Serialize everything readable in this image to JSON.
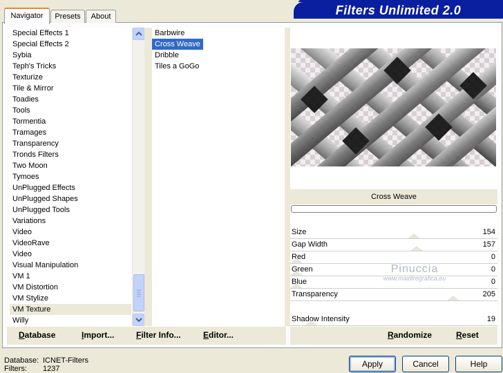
{
  "banner": {
    "title": "Filters Unlimited 2.0"
  },
  "tabs": [
    {
      "label": "Navigator"
    },
    {
      "label": "Presets"
    },
    {
      "label": "About"
    }
  ],
  "categories": {
    "items": [
      "Special Effects 1",
      "Special Effects 2",
      "Sybia",
      "Teph's Tricks",
      "Texturize",
      "Tile & Mirror",
      "Toadies",
      "Tools",
      "Tormentia",
      "Tramages",
      "Transparency",
      "Tronds Filters",
      "Two Moon",
      "Tymoes",
      "UnPlugged Effects",
      "UnPlugged Shapes",
      "UnPlugged Tools",
      "Variations",
      "Video",
      "VideoRave",
      "Video",
      "Visual Manipulation",
      "VM 1",
      "VM Distortion",
      "VM Stylize",
      "VM Texture",
      "Willy"
    ],
    "selected": "VM Texture"
  },
  "filters": {
    "items": [
      "Barbwire",
      "Cross Weave",
      "Dribble",
      "Tiles a GoGo"
    ],
    "selected": "Cross Weave"
  },
  "preview": {
    "filter_name": "Cross Weave"
  },
  "left_buttons": {
    "database": "Database",
    "import": "Import...",
    "filter_info": "Filter Info...",
    "editor": "Editor..."
  },
  "right_buttons": {
    "randomize": "Randomize",
    "reset": "Reset"
  },
  "params": [
    {
      "label": "Size",
      "value": "154",
      "level": 154
    },
    {
      "label": "Gap Width",
      "value": "157",
      "level": 157
    },
    {
      "label": "Red",
      "value": "0",
      "level": 0
    },
    {
      "label": "Green",
      "value": "0",
      "level": 0
    },
    {
      "label": "Blue",
      "value": "0",
      "level": 0
    },
    {
      "label": "Transparency",
      "value": "205",
      "level": 205
    },
    {
      "label": "Shadow Intensity",
      "value": "19",
      "level": 19
    }
  ],
  "watermark": {
    "line1": "Pinuccia",
    "line2": "www.maidiregrafica.eu"
  },
  "status": {
    "database_label": "Database:",
    "database_value": "ICNET-Filters",
    "filters_label": "Filters:",
    "filters_value": "1237"
  },
  "dialog_buttons": {
    "apply": "Apply",
    "cancel": "Cancel",
    "help": "Help"
  },
  "colors": {
    "banner": "#0a1fa0",
    "selection": "#316ac5",
    "tab_accent": "#e68b2c"
  }
}
